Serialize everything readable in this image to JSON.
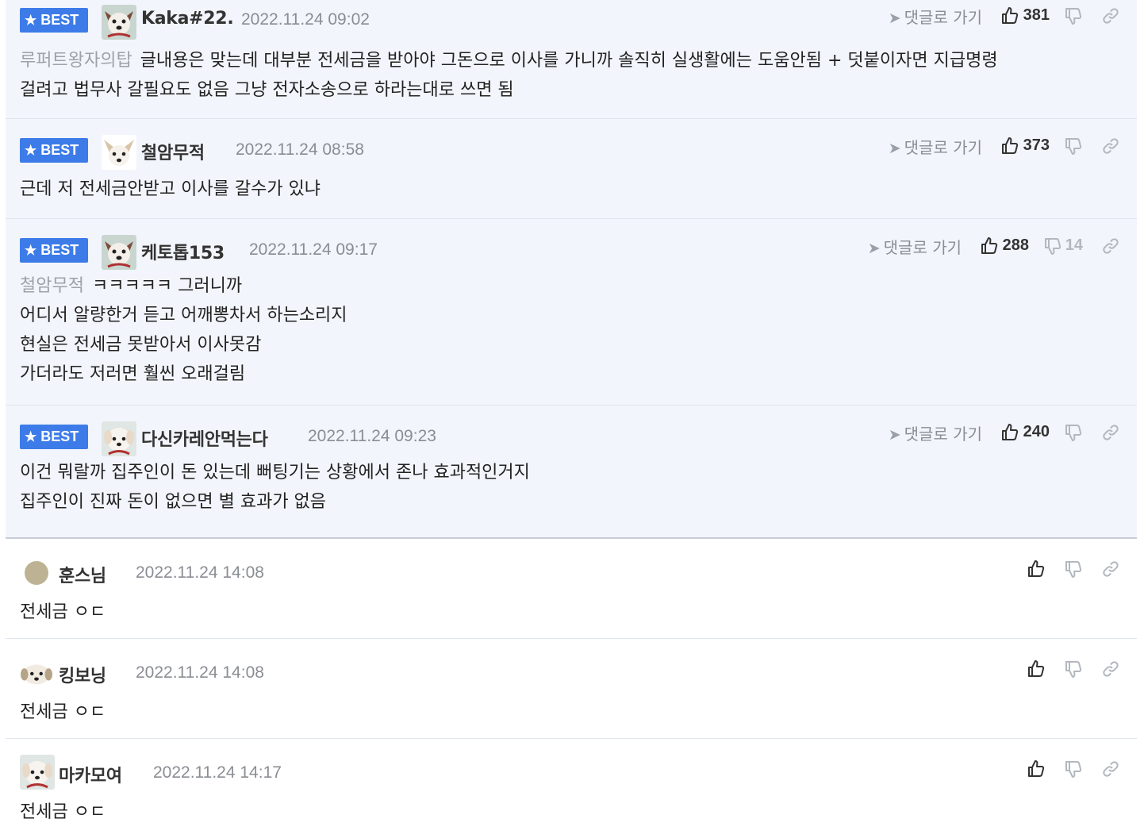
{
  "labels": {
    "best": "BEST",
    "goto_reply": "댓글로 가기"
  },
  "colors": {
    "best_badge": "#3d7ce8",
    "best_bg": "#f2f5fb",
    "muted": "#8a8d93"
  },
  "best_comments": [
    {
      "nickname": "Kaka#22.",
      "date": "2022.11.24 09:02",
      "likes": "381",
      "dislikes": "",
      "reply_to": "루퍼트왕자의탑",
      "lines": [
        "글내용은 맞는데 대부분 전세금을 받아야 그돈으로 이사를 가니까 솔직히 실생활에는 도움안됨 + 덧붙이자면 지급명령",
        "걸려고 법무사 갈필요도 없음 그냥 전자소송으로 하라는대로 쓰면 됨"
      ]
    },
    {
      "nickname": "철암무적",
      "date": "2022.11.24 08:58",
      "likes": "373",
      "dislikes": "",
      "reply_to": "",
      "lines": [
        "근데 저 전세금안받고 이사를 갈수가 있냐"
      ]
    },
    {
      "nickname": "케토톱153",
      "date": "2022.11.24 09:17",
      "likes": "288",
      "dislikes": "14",
      "reply_to": "철암무적",
      "lines": [
        "ㅋㅋㅋㅋㅋ 그러니까",
        "어디서 알량한거 듣고 어깨뽕차서 하는소리지",
        "현실은 전세금 못받아서 이사못감",
        "가더라도 저러면 훨씬 오래걸림"
      ]
    },
    {
      "nickname": "다신카레안먹는다",
      "date": "2022.11.24 09:23",
      "likes": "240",
      "dislikes": "",
      "reply_to": "",
      "lines": [
        "이건 뭐랄까 집주인이 돈 있는데 뻐팅기는 상황에서 존나 효과적인거지",
        "집주인이 진짜 돈이 없으면 별 효과가 없음"
      ]
    }
  ],
  "comments": [
    {
      "nickname": "훈스님",
      "date": "2022.11.24 14:08",
      "text": "전세금 ㅇㄷ"
    },
    {
      "nickname": "킹보닝",
      "date": "2022.11.24 14:08",
      "text": "전세금 ㅇㄷ"
    },
    {
      "nickname": "마카모여",
      "date": "2022.11.24 14:17",
      "text": "전세금 ㅇㄷ"
    }
  ]
}
